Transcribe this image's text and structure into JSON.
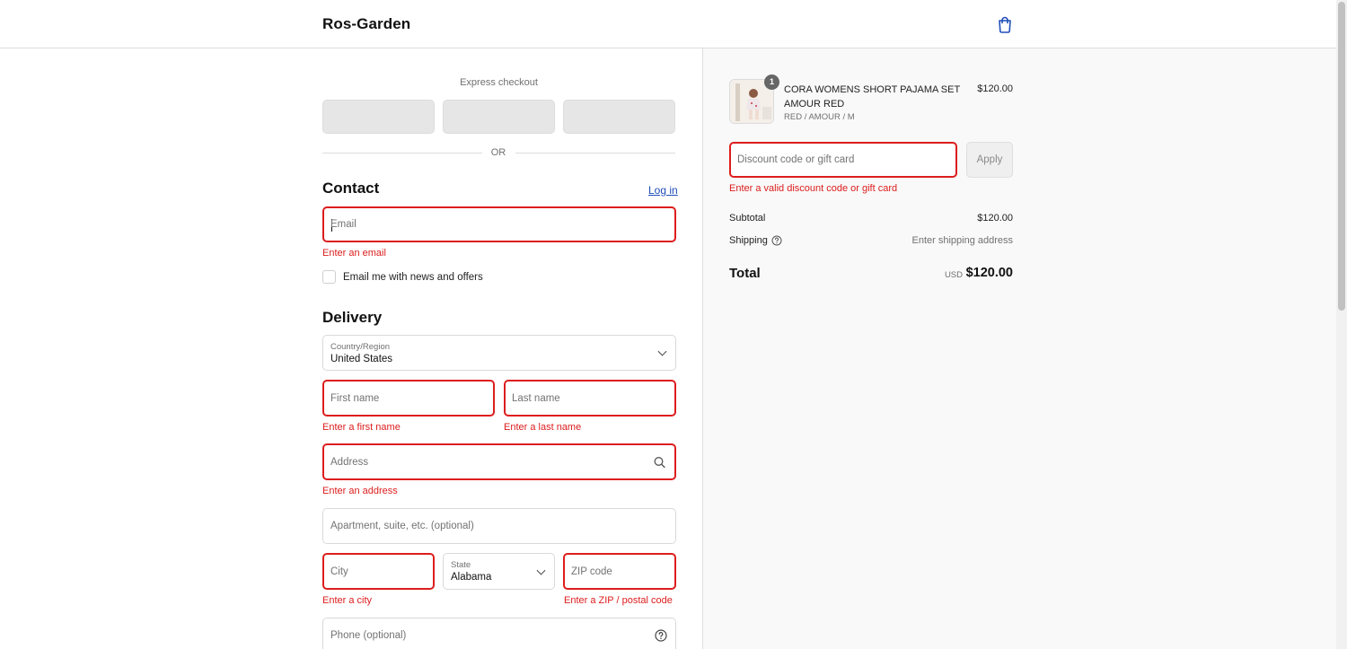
{
  "header": {
    "brand": "Ros-Garden",
    "cart_icon": "shopping-bag-icon"
  },
  "express": {
    "label": "Express checkout",
    "or_text": "OR"
  },
  "contact": {
    "title": "Contact",
    "login_label": "Log in",
    "email_placeholder": "Email",
    "email_error": "Enter an email",
    "newsletter_label": "Email me with news and offers",
    "newsletter_checked": false
  },
  "delivery": {
    "title": "Delivery",
    "country_label": "Country/Region",
    "country_value": "United States",
    "first_name_placeholder": "First name",
    "first_name_error": "Enter a first name",
    "last_name_placeholder": "Last name",
    "last_name_error": "Enter a last name",
    "address_placeholder": "Address",
    "address_error": "Enter an address",
    "apartment_placeholder": "Apartment, suite, etc. (optional)",
    "city_placeholder": "City",
    "city_error": "Enter a city",
    "state_label": "State",
    "state_value": "Alabama",
    "zip_placeholder": "ZIP code",
    "zip_error": "Enter a ZIP / postal code",
    "phone_placeholder": "Phone (optional)"
  },
  "summary": {
    "item": {
      "name": "CORA WOMENS SHORT PAJAMA SET AMOUR RED",
      "variant": "RED / AMOUR / M",
      "price": "$120.00",
      "quantity": "1"
    },
    "discount_placeholder": "Discount code or gift card",
    "apply_label": "Apply",
    "discount_error": "Enter a valid discount code or gift card",
    "subtotal_label": "Subtotal",
    "subtotal_value": "$120.00",
    "shipping_label": "Shipping",
    "shipping_value": "Enter shipping address",
    "total_label": "Total",
    "currency": "USD",
    "total_value": "$120.00"
  },
  "colors": {
    "error": "#dd1d1d",
    "link": "#1f4db8",
    "panel_bg": "#f9f9f9"
  }
}
